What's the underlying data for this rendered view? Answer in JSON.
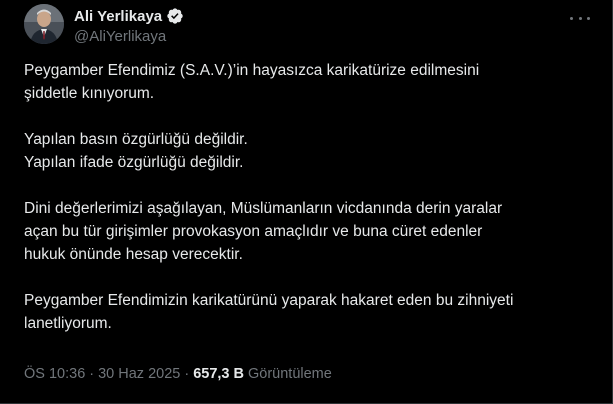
{
  "author": {
    "display_name": "Ali Yerlikaya",
    "handle": "@AliYerlikaya"
  },
  "icons": {
    "avatar": "profile-photo",
    "verified": "verified-badge-icon",
    "more": "more-options-icon"
  },
  "colors": {
    "background": "#000000",
    "text": "#e7e9ea",
    "muted": "#71767b",
    "verified_badge": "#e7e9ea"
  },
  "tweet": {
    "paragraphs": [
      {
        "lines": [
          "Peygamber Efendimiz (S.A.V.)’in hayasızca karikatürize edilmesini",
          "şiddetle kınıyorum."
        ]
      },
      {
        "lines": [
          "Yapılan basın özgürlüğü değildir.",
          "Yapılan ifade özgürlüğü değildir."
        ]
      },
      {
        "lines": [
          "Dini değerlerimizi aşağılayan, Müslümanların vicdanında derin yaralar",
          "açan bu tür girişimler provokasyon amaçlıdır ve buna cüret edenler",
          "hukuk önünde hesap verecektir."
        ]
      },
      {
        "lines": [
          "Peygamber Efendimizin karikatürünü yaparak hakaret eden bu zihniyeti",
          "lanetliyorum."
        ]
      }
    ]
  },
  "meta": {
    "time": "ÖS 10:36",
    "separator": "·",
    "date": "30 Haz 2025",
    "views_count": "657,3 B",
    "views_label": "Görüntüleme"
  }
}
